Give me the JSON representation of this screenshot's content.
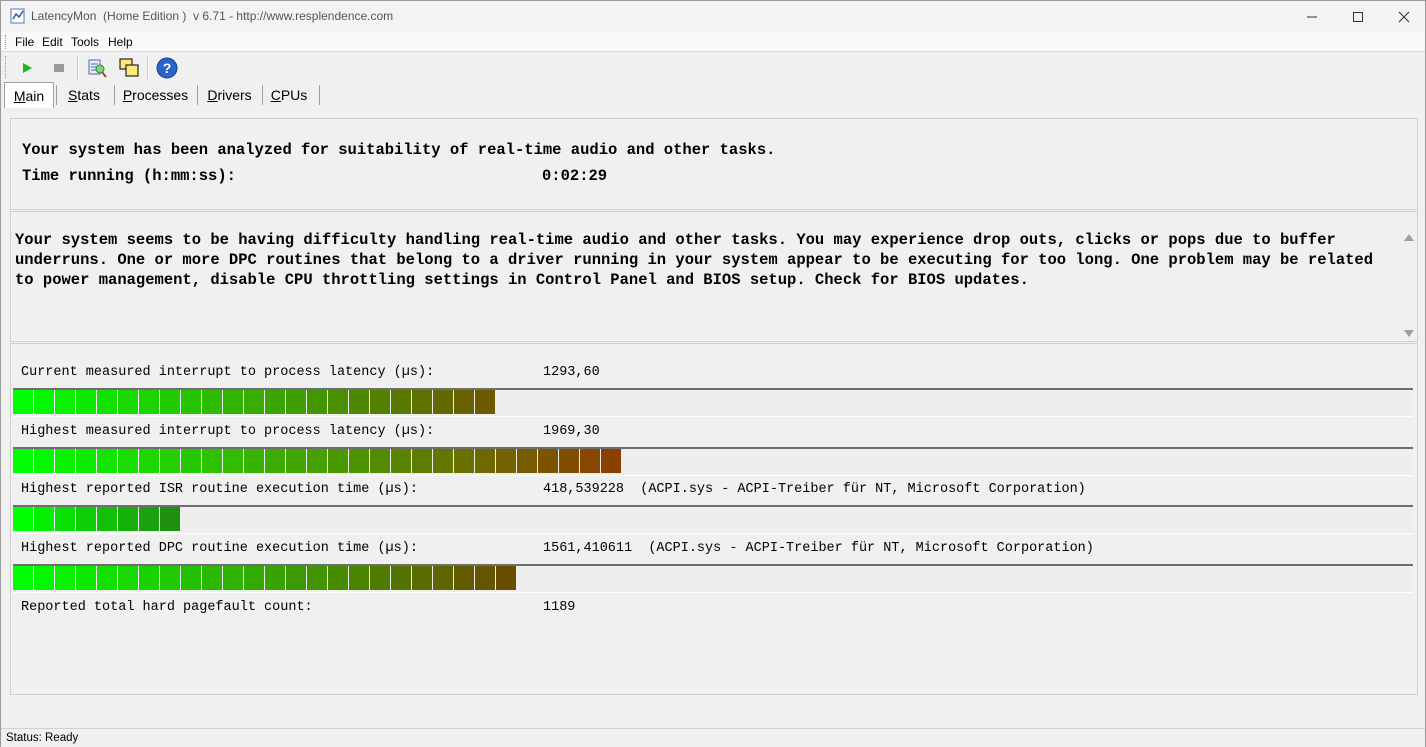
{
  "window": {
    "title": "LatencyMon  (Home Edition )  v 6.71 - http://www.resplendence.com"
  },
  "menu": [
    "File",
    "Edit",
    "Tools",
    "Help"
  ],
  "toolbar": {
    "buttons": [
      "start-icon",
      "stop-icon",
      "report-icon",
      "windows-icon",
      "help-icon"
    ]
  },
  "tabs": [
    "Main",
    "Stats",
    "Processes",
    "Drivers",
    "CPUs"
  ],
  "summary": {
    "line1": "Your system has been analyzed for suitability of real-time audio and other tasks.",
    "time_label": "Time running (h:mm:ss):",
    "time_value": "0:02:29"
  },
  "message": "Your system seems to be having difficulty handling real-time audio and other tasks. You may experience drop outs, clicks or pops due to buffer underruns. One or more DPC routines that belong to a driver running in your system appear to be executing for too long. One problem may be related to power management, disable CPU throttling settings in Control Panel and BIOS setup. Check for BIOS updates.",
  "metrics": [
    {
      "label": "Current measured interrupt to process latency (µs):",
      "value": "1293,60",
      "bar_segments": 23,
      "bar_colors": {
        "start": "#00ff00",
        "end": "#6b5a00"
      }
    },
    {
      "label": "Highest measured interrupt to process latency (µs):",
      "value": "1969,30",
      "bar_segments": 29,
      "bar_colors": {
        "start": "#00ff00",
        "end": "#8b4000"
      }
    },
    {
      "label": "Highest reported ISR routine execution time (µs):",
      "value": "418,539228  (ACPI.sys - ACPI-Treiber für NT, Microsoft Corporation)",
      "bar_segments": 8,
      "bar_colors": {
        "start": "#00ff00",
        "end": "#209010"
      }
    },
    {
      "label": "Highest reported DPC routine execution time (µs):",
      "value": "1561,410611  (ACPI.sys - ACPI-Treiber für NT, Microsoft Corporation)",
      "bar_segments": 24,
      "bar_colors": {
        "start": "#00ff00",
        "end": "#6b4d00"
      }
    },
    {
      "label": "Reported total hard pagefault count:",
      "value": "1189"
    }
  ],
  "status": "Status: Ready"
}
